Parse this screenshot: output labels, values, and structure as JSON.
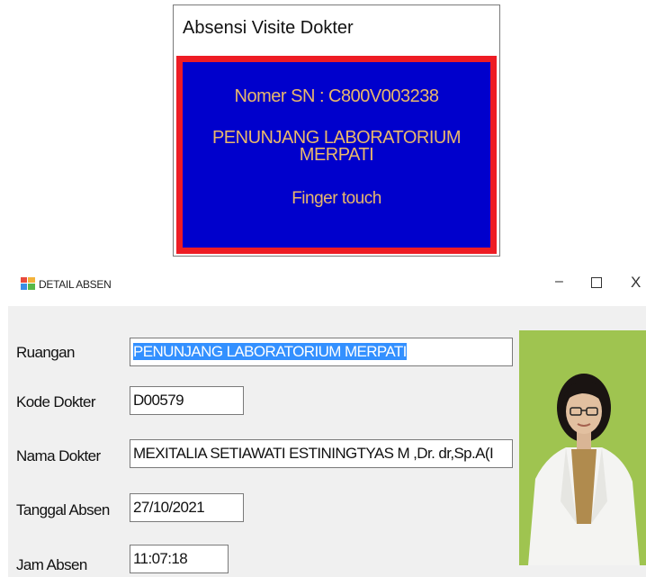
{
  "top_dialog": {
    "title": "Absensi Visite Dokter",
    "serial_line": "Nomer SN : C800V003238",
    "location_line1": "PENUNJANG LABORATORIUM",
    "location_line2": "MERPATI",
    "status": "Finger touch",
    "colors": {
      "border": "#ee1c24",
      "panel": "#0000cc",
      "text": "#e9b86c"
    }
  },
  "detail_window": {
    "title": "DETAIL ABSEN",
    "controls": {
      "minimize": "–",
      "close": "X"
    },
    "fields": {
      "ruangan": {
        "label": "Ruangan",
        "value": "PENUNJANG LABORATORIUM MERPATI"
      },
      "kode_dokter": {
        "label": "Kode Dokter",
        "value": "D00579"
      },
      "nama_dokter": {
        "label": "Nama Dokter",
        "value": "MEXITALIA SETIAWATI ESTININGTYAS M ,Dr. dr,Sp.A(I"
      },
      "tanggal_absen": {
        "label": "Tanggal Absen",
        "value": "27/10/2021"
      },
      "jam_absen": {
        "label": "Jam Absen",
        "value": "11:07:18"
      }
    },
    "colors": {
      "selection": "#3390ff",
      "photo_bg": "#9fc450"
    }
  }
}
